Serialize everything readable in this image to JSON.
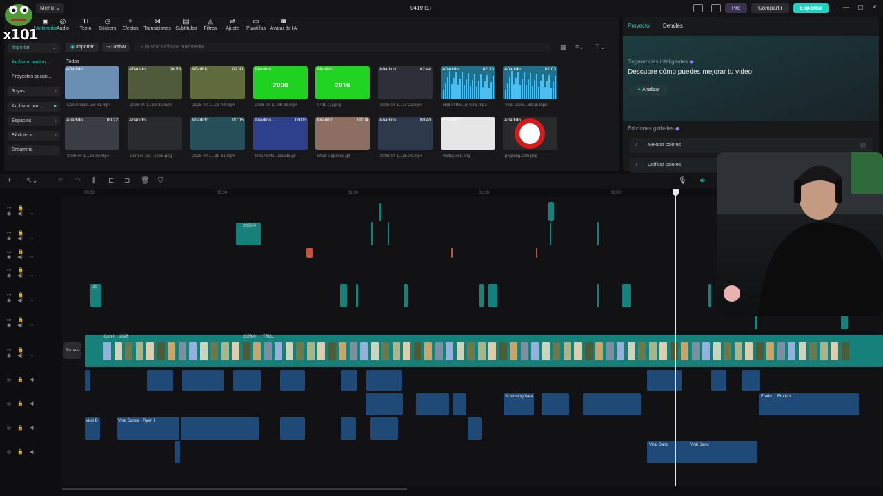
{
  "topbar": {
    "menu_label": "Menú",
    "title": "0419 (1)",
    "pro_label": "Pro",
    "share_label": "Compartir",
    "export_label": "Exportar"
  },
  "tools": [
    {
      "label": "Multimedia",
      "icon": "media-icon"
    },
    {
      "label": "Audio",
      "icon": "audio-icon"
    },
    {
      "label": "Texto",
      "icon": "text-icon"
    },
    {
      "label": "Stickers",
      "icon": "sticker-icon"
    },
    {
      "label": "Efectos",
      "icon": "effects-icon"
    },
    {
      "label": "Transiciones",
      "icon": "transitions-icon"
    },
    {
      "label": "Subtítulos",
      "icon": "subtitles-icon"
    },
    {
      "label": "Filtros",
      "icon": "filters-icon"
    },
    {
      "label": "Ajuste",
      "icon": "adjust-icon"
    },
    {
      "label": "Plantillas",
      "icon": "templates-icon"
    },
    {
      "label": "Avatar de IA",
      "icon": "ai-avatar-icon"
    }
  ],
  "sidebar": {
    "items": [
      {
        "label": "Importar"
      },
      {
        "label": "Archivos multim..."
      },
      {
        "label": "Proyectos secun..."
      },
      {
        "label": "Tuyos"
      },
      {
        "label": "Archivos mu..."
      },
      {
        "label": "Espacios"
      },
      {
        "label": "Biblioteca"
      },
      {
        "label": "Dreamina"
      }
    ]
  },
  "media": {
    "import_label": "Importar",
    "record_label": "Grabar",
    "search_placeholder": "Buscar archivos multimedia",
    "section_label": "Todos",
    "added_label": "Añadido",
    "thumbs": [
      {
        "duration": "",
        "caption": "Con Shade...on #1.mp4",
        "overlay": "",
        "color": "#6a8fb3"
      },
      {
        "duration": "04:59",
        "caption": "2026-04-1...39-32.mp4",
        "overlay": "",
        "color": "#4e5a3a"
      },
      {
        "duration": "02:41",
        "caption": "2026-04-1...01-44.mp4",
        "overlay": "",
        "color": "#5f6b3c"
      },
      {
        "duration": "",
        "caption": "2026-04-1...09-39.mp4",
        "overlay": "2000",
        "color": "#1fd21f"
      },
      {
        "duration": "",
        "caption": "0419 (1).png",
        "overlay": "2016",
        "color": "#22d422"
      },
      {
        "duration": "02:44",
        "caption": "2026-04-1...14-22.mp4",
        "overlay": "",
        "color": "#2f2f3a"
      },
      {
        "duration": "02:33",
        "caption": "Hall of the...in King.mp3",
        "overlay": "",
        "color": "#1f6f8a"
      },
      {
        "duration": "02:03",
        "caption": "Viral Danc...Steak.mp3",
        "overlay": "",
        "color": "#1f6f8a"
      },
      {
        "duration": "00:22",
        "caption": "2026-04-1...26-39.mp4",
        "overlay": "",
        "color": "#3a3d44"
      },
      {
        "duration": "",
        "caption": "Gemini_Ge...ceix5.png",
        "overlay": "",
        "color": "#2a2b2e"
      },
      {
        "duration": "00:05",
        "caption": "2026-04-1...39-31.mp4",
        "overlay": "",
        "color": "#264f5a"
      },
      {
        "duration": "00:03",
        "caption": "fc4a7374c...ei15de.gif",
        "overlay": "",
        "color": "#2e3f8c"
      },
      {
        "duration": "00:04",
        "caption": "what-surprised.gif",
        "overlay": "",
        "color": "#8c6f62"
      },
      {
        "duration": "00:40",
        "caption": "2026-04-1...35-30.mp4",
        "overlay": "",
        "color": "#2c3a4c"
      },
      {
        "duration": "",
        "caption": "visitas.xed.png",
        "overlay": "",
        "color": "#e6e6e6"
      },
      {
        "duration": "",
        "caption": "pngwing.com.png",
        "overlay": "",
        "color": "#2a2a2c"
      }
    ]
  },
  "right_panel": {
    "tab_project": "Proyecto",
    "tab_details": "Detalles",
    "suggestions_title": "Sugerencias inteligentes",
    "suggestions_desc": "Descubre cómo puedes mejorar tu video",
    "analyze_label": "Analizar",
    "global_title": "Ediciones globales",
    "global_items": [
      {
        "label": "Mejorar colores"
      },
      {
        "label": "Unificar colores"
      }
    ]
  },
  "timeline": {
    "ruler_labels": [
      "00:00",
      "00:30",
      "01:00",
      "01:30",
      "02:00"
    ],
    "cover_label": "Portada",
    "clip_labels": {
      "overlay_clip": "2026-0",
      "small_a": "20",
      "audio_a1": "Viral D",
      "audio_a2": "Viral Dance - Ryan I",
      "audio_b1": "Scheming Wea",
      "audio_c1": "Viral Danc",
      "audio_c2": "Viral Danc",
      "audio_d1": "Frodo",
      "audio_d2": "Frodo's",
      "main_1": "Con I",
      "main_2": "2026",
      "main_3": "2026-0",
      "main_4": "TROL"
    }
  },
  "overlay": {
    "logo_text": "x101"
  },
  "colors": {
    "accent": "#1fd1c0",
    "video_clip": "#16807a",
    "audio_clip": "#1f4a78"
  }
}
